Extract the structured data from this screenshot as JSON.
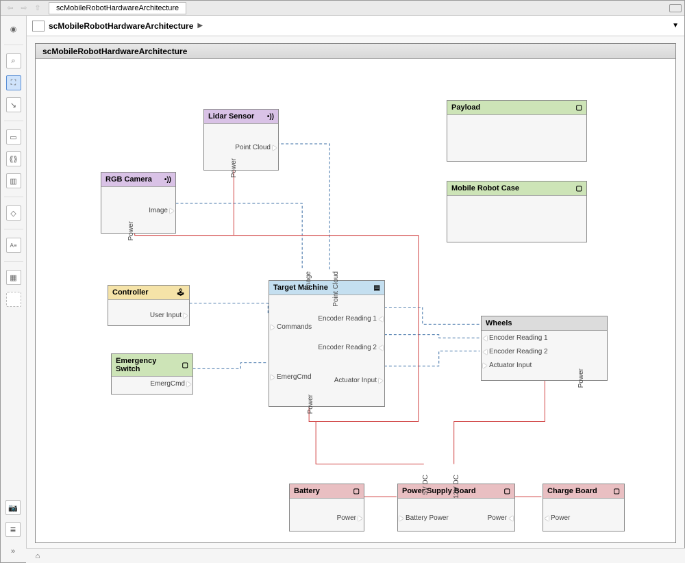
{
  "tab_title": "scMobileRobotHardwareArchitecture",
  "breadcrumb": "scMobileRobotHardwareArchitecture",
  "canvas_title": "scMobileRobotHardwareArchitecture",
  "blocks": {
    "lidar": {
      "title": "Lidar Sensor",
      "ports": {
        "point_cloud": "Point Cloud",
        "power": "Power"
      }
    },
    "rgb": {
      "title": "RGB Camera",
      "ports": {
        "image": "Image",
        "power": "Power"
      }
    },
    "controller": {
      "title": "Controller",
      "ports": {
        "user_input": "User Input"
      }
    },
    "emerg": {
      "title": "Emergency Switch",
      "ports": {
        "emergcmd": "EmergCmd"
      }
    },
    "target": {
      "title": "Target Machine",
      "ports": {
        "commands": "Commands",
        "emergcmd": "EmergCmd",
        "enc1": "Encoder Reading 1",
        "enc2": "Encoder Reading 2",
        "act": "Actuator Input",
        "power": "Power",
        "image": "Image",
        "pc": "Point Cloud"
      }
    },
    "payload": {
      "title": "Payload"
    },
    "case": {
      "title": "Mobile Robot Case"
    },
    "wheels": {
      "title": "Wheels",
      "ports": {
        "enc1": "Encoder Reading 1",
        "enc2": "Encoder Reading 2",
        "act": "Actuator Input",
        "power": "Power"
      }
    },
    "battery": {
      "title": "Battery",
      "ports": {
        "power": "Power"
      }
    },
    "psb": {
      "title": "Power Supply Board",
      "ports": {
        "batt": "Battery Power",
        "power": "Power",
        "dc5": "5V DC",
        "dc12": "12V DC"
      }
    },
    "charge": {
      "title": "Charge Board",
      "ports": {
        "power": "Power"
      }
    }
  }
}
